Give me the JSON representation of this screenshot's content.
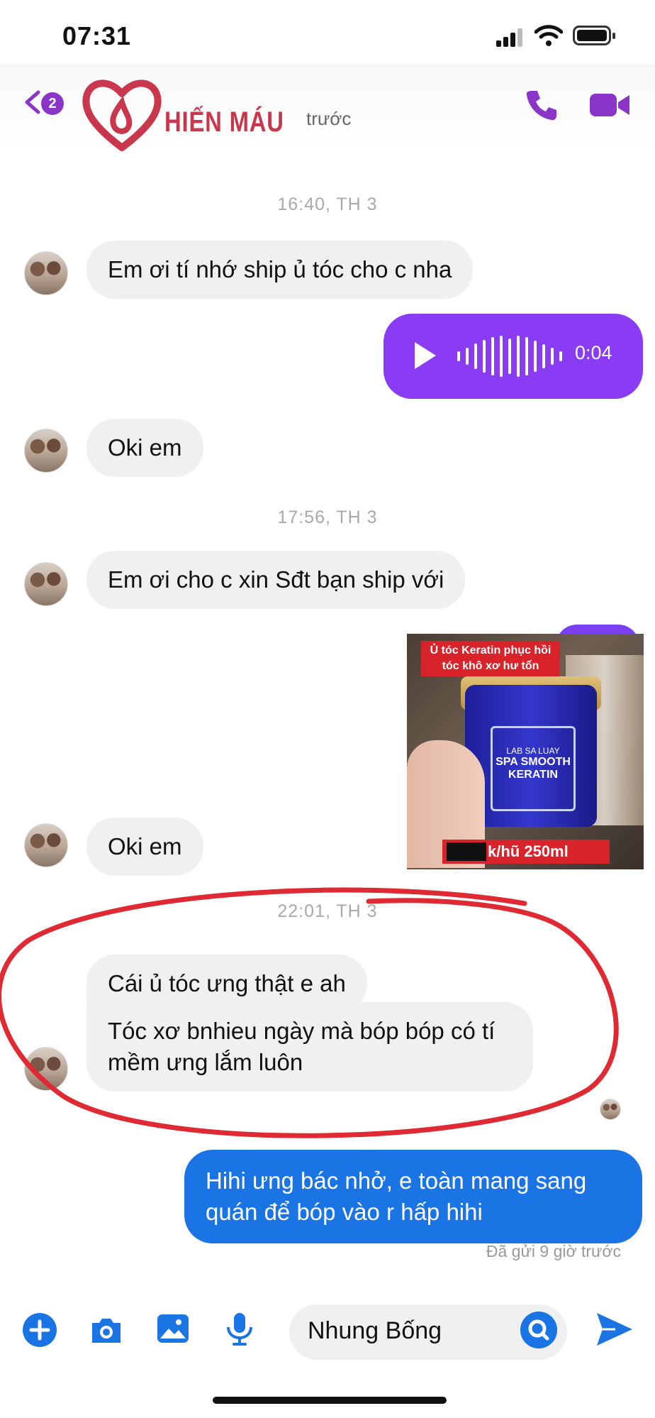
{
  "status_bar": {
    "time": "07:31"
  },
  "header": {
    "back_count": "2",
    "logo_text": "HIẾN MÁU",
    "subtitle": "trước",
    "colors": {
      "accent": "#8a34c8",
      "logo": "#c9374d"
    }
  },
  "conversation": {
    "timestamps": [
      "16:40, TH 3",
      "17:56, TH 3",
      "22:01, TH 3"
    ],
    "incoming": [
      "Em ơi tí nhớ ship ủ tóc cho c nha",
      "Oki em",
      "Em ơi cho c xin Sđt bạn ship với",
      "Oki em",
      "Cái ủ tóc ưng thật e ah",
      "Tóc xơ bnhieu ngày mà bóp bóp có tí mềm ưng lắm luôn"
    ],
    "voice_message": {
      "duration": "0:04",
      "color": "#8a3cf4"
    },
    "product_image": {
      "caption": "Ủ tóc Keratin phục hồi tóc khô xơ hư tổn",
      "brand": "LAB SA LUAY",
      "product": "SPA SMOOTH KERATIN",
      "price": "k/hũ 250ml"
    },
    "outgoing": [
      "Hihi ưng bác nhở, e toàn mang sang quán để bóp vào r hấp hihi"
    ],
    "seen_status": "Đã gửi 9 giờ trước",
    "outgoing_color": "#1b74e4"
  },
  "composer": {
    "input_value": "Nhung Bống",
    "icons": [
      "add-icon",
      "camera-icon",
      "image-icon",
      "microphone-icon",
      "emoji-icon",
      "send-icon"
    ]
  }
}
